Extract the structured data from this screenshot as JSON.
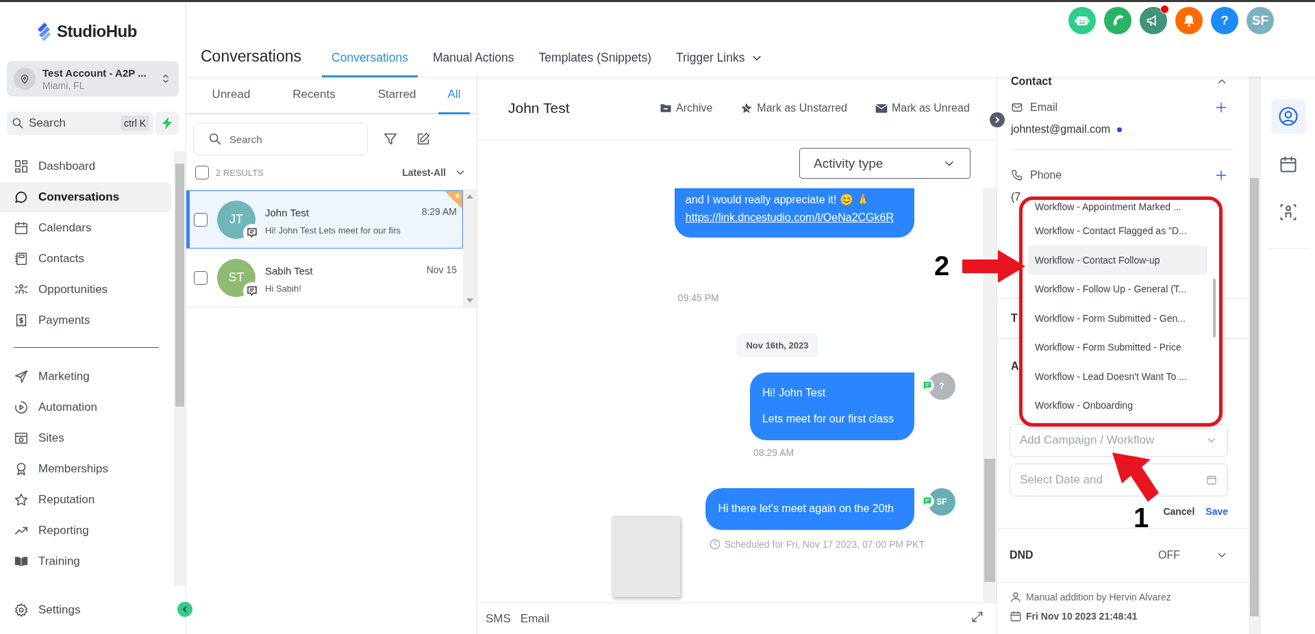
{
  "brand": {
    "name": "StudioHub"
  },
  "account": {
    "name": "Test Account - A2P ...",
    "location": "Miami, FL"
  },
  "sidebar_search": {
    "placeholder": "Search",
    "shortcut": "ctrl K"
  },
  "sidebar": {
    "items": [
      {
        "label": "Dashboard",
        "selected": false
      },
      {
        "label": "Conversations",
        "selected": true
      },
      {
        "label": "Calendars",
        "selected": false
      },
      {
        "label": "Contacts",
        "selected": false
      },
      {
        "label": "Opportunities",
        "selected": false
      },
      {
        "label": "Payments",
        "selected": false
      }
    ],
    "items_2": [
      {
        "label": "Marketing",
        "selected": false
      },
      {
        "label": "Automation",
        "selected": false
      },
      {
        "label": "Sites",
        "selected": false
      },
      {
        "label": "Memberships",
        "selected": false
      },
      {
        "label": "Reputation",
        "selected": false
      },
      {
        "label": "Reporting",
        "selected": false
      },
      {
        "label": "Training",
        "selected": false
      }
    ],
    "settings": "Settings"
  },
  "header": {
    "title": "Conversations",
    "tabs": [
      {
        "label": "Conversations",
        "selected": true
      },
      {
        "label": "Manual Actions",
        "selected": false
      },
      {
        "label": "Templates (Snippets)",
        "selected": false
      },
      {
        "label": "Trigger Links",
        "selected": false
      }
    ],
    "icons": [
      {
        "kind": "bot",
        "badge": false
      },
      {
        "kind": "phone",
        "badge": false
      },
      {
        "kind": "megaphone",
        "badge": true
      },
      {
        "kind": "bell",
        "badge": false
      },
      {
        "kind": "help",
        "text": "?",
        "badge": false
      },
      {
        "kind": "avatar",
        "text": "SF",
        "badge": false
      }
    ]
  },
  "inbox": {
    "tabs": [
      {
        "label": "Unread",
        "selected": false
      },
      {
        "label": "Recents",
        "selected": false
      },
      {
        "label": "Starred",
        "selected": false
      },
      {
        "label": "All",
        "selected": true
      }
    ],
    "search": {
      "placeholder": "Search"
    },
    "select_all": {
      "checked": false
    },
    "results": "2 RESULTS",
    "sort": "Latest-All",
    "conversations": [
      {
        "initials": "JT",
        "name": "John Test",
        "time": "8:29 AM",
        "preview": "Hi! John Test Lets meet for our firs",
        "color": "#6fb6ba",
        "selected": true,
        "checked": false,
        "starred": true
      },
      {
        "initials": "ST",
        "name": "Sabih Test",
        "time": "Nov 15",
        "preview": "Hi Sabih!",
        "color": "#8fbc72",
        "selected": false,
        "checked": false,
        "starred": false
      }
    ]
  },
  "chat": {
    "contact": "John Test",
    "actions": [
      "Archive",
      "Mark as Unstarred",
      "Mark as Unread"
    ],
    "activity_filter": {
      "placeholder": "Activity type"
    },
    "messages": [
      {
        "kind": "message",
        "lines": [
          "and I would really appreciate it! 😊 🙏"
        ],
        "link": "https://link.dncestudio.com/l/OeNa2CGk6R",
        "time": "09:45 PM"
      },
      {
        "kind": "date",
        "text": "Nov 16th, 2023"
      },
      {
        "kind": "message",
        "lines": [
          "Hi! John Test",
          "Lets meet for our first class"
        ],
        "avatar": "?",
        "color": "#b1b6bb",
        "time": "08:29 AM"
      },
      {
        "kind": "message",
        "lines": [
          "Hi there let's meet again on the 20th"
        ],
        "avatar": "SF",
        "color": "#6aaeb4",
        "scheduled": "Scheduled for Fri, Nov 17 2023, 07:00 PM PKT"
      }
    ],
    "composer": {
      "channels": [
        "SMS",
        "Email"
      ]
    }
  },
  "contact_panel": {
    "title": "Contact",
    "email_label": "Email",
    "email": "johntest@gmail.com",
    "email_primary": true,
    "phone_label": "Phone",
    "phone": "(7",
    "section_1": "T",
    "section_2": "A",
    "campaign_field": {
      "placeholder": "Add Campaign / Workflow"
    },
    "date_field": {
      "placeholder": "Select Date and"
    },
    "buttons": [
      "Cancel",
      "Save"
    ],
    "dnd": {
      "label": "DND",
      "value": "OFF"
    },
    "history": {
      "note": "Manual addition by Hervin Alvarez",
      "date": "Fri Nov 10 2023 21:48:41"
    }
  },
  "workflow_menu": {
    "items": [
      {
        "label": "Workflow - Appointment Marked ...",
        "selected": false
      },
      {
        "label": "Workflow - Contact Flagged as \"D...",
        "selected": false
      },
      {
        "label": "Workflow - Contact Follow-up",
        "selected": true
      },
      {
        "label": "Workflow - Follow Up - General (T...",
        "selected": false
      },
      {
        "label": "Workflow - Form Submitted - Gen...",
        "selected": false
      },
      {
        "label": "Workflow - Form Submitted - Price",
        "selected": false
      },
      {
        "label": "Workflow - Lead Doesn't Want To ...",
        "selected": false
      },
      {
        "label": "Workflow - Onboarding",
        "selected": false
      }
    ]
  },
  "annotations": [
    {
      "kind": "arrow_right",
      "label": "2"
    },
    {
      "kind": "arrow_up",
      "label": "1"
    }
  ]
}
